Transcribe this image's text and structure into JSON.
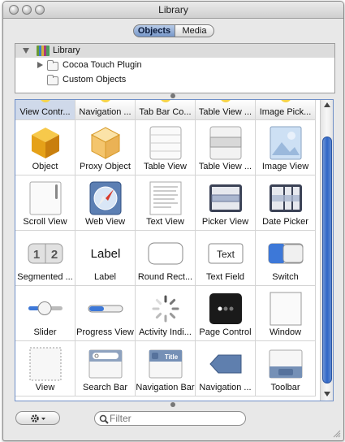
{
  "window": {
    "title": "Library"
  },
  "tabs": {
    "objects": "Objects",
    "media": "Media"
  },
  "outline": {
    "items": [
      {
        "label": "Library",
        "icon": "library-books-icon"
      },
      {
        "label": "Cocoa Touch Plugin",
        "icon": "folder-icon"
      },
      {
        "label": "Custom Objects",
        "icon": "folder-icon"
      }
    ]
  },
  "header_row": [
    "View Contr...",
    "Navigation ...",
    "Tab Bar Co...",
    "Table View ...",
    "Image Pick..."
  ],
  "objects": [
    [
      "Object",
      "Proxy Object",
      "Table View",
      "Table View ...",
      "Image View"
    ],
    [
      "Scroll View",
      "Web View",
      "Text View",
      "Picker View",
      "Date Picker"
    ],
    [
      "Segmented ...",
      "Label",
      "Round Rect...",
      "Text Field",
      "Switch"
    ],
    [
      "Slider",
      "Progress View",
      "Activity Indi...",
      "Page Control",
      "Window"
    ],
    [
      "View",
      "Search Bar",
      "Navigation Bar",
      "Navigation ...",
      "Toolbar"
    ]
  ],
  "icon_text": {
    "segment_1": "1",
    "segment_2": "2",
    "label_icon": "Label",
    "textfield_icon": "Text",
    "navbar_icon": "Title"
  },
  "filter": {
    "placeholder": "Filter"
  },
  "colors": {
    "accent": "#2f66c6",
    "selection": "#cfd9ea"
  }
}
